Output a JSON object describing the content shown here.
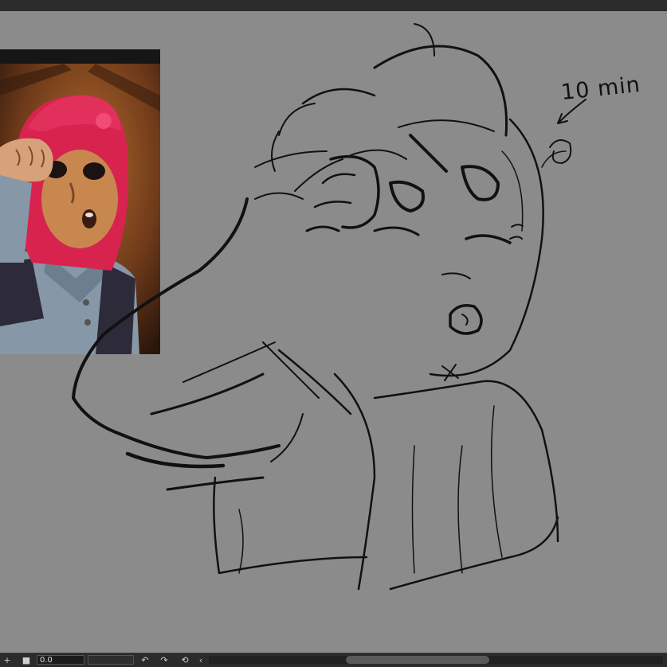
{
  "annotation": {
    "text": "10 min"
  },
  "statusbar": {
    "add_icon": "plus-icon",
    "stop_icon": "square-icon",
    "rotation_value": "0.0",
    "undo_icon": "undo-icon",
    "redo_icon": "redo-icon",
    "reset_icon": "reset-rotation-icon",
    "scroll_left_icon": "chevron-left-icon",
    "add_glyph": "+",
    "stop_glyph": "■",
    "undo_glyph": "↶",
    "redo_glyph": "↷",
    "reset_glyph": "⟲",
    "scroll_left_glyph": "‹"
  },
  "colors": {
    "canvas": "#8b8b8b",
    "ink": "#111111",
    "hair": "#d8234f",
    "ui_dark": "#2b2b2b"
  }
}
